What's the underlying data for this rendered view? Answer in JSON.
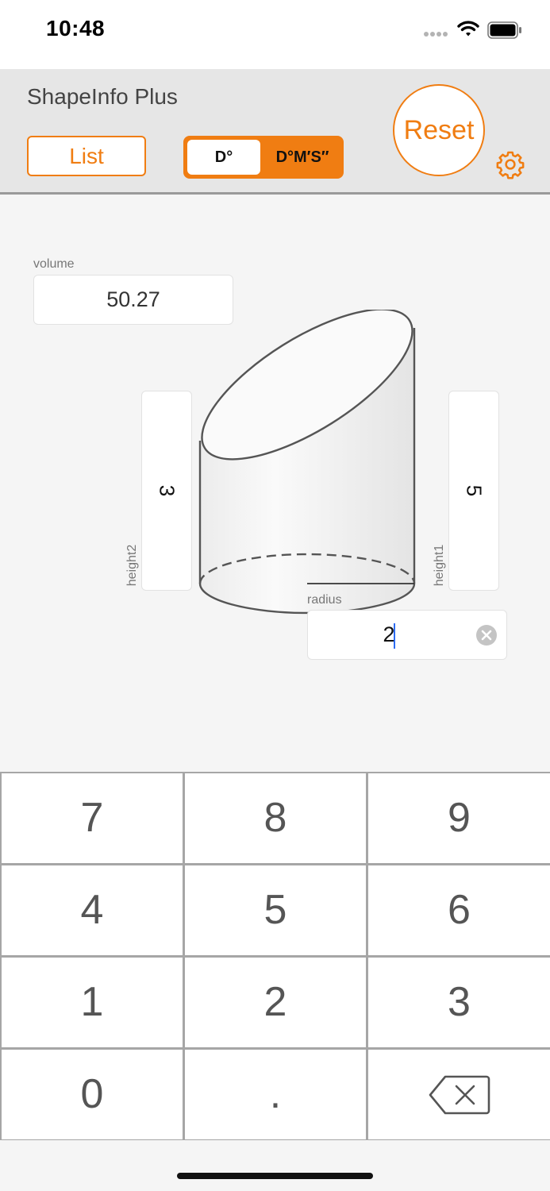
{
  "status_bar": {
    "time": "10:48"
  },
  "header": {
    "title": "ShapeInfo Plus",
    "list_label": "List",
    "angle_options": [
      "D°",
      "D°M′S″"
    ],
    "angle_selected": "D°",
    "reset_label": "Reset"
  },
  "fields": {
    "volume": {
      "label": "volume",
      "value": "50.27"
    },
    "height2": {
      "label": "height2",
      "value": "3"
    },
    "height1": {
      "label": "height1",
      "value": "5"
    },
    "radius": {
      "label": "radius",
      "value": "2"
    }
  },
  "keypad": {
    "keys": [
      "7",
      "8",
      "9",
      "4",
      "5",
      "6",
      "1",
      "2",
      "3",
      "0",
      ".",
      "backspace"
    ]
  },
  "colors": {
    "accent": "#f07d12",
    "header_bg": "#e6e6e6",
    "page_bg": "#f5f5f5"
  }
}
